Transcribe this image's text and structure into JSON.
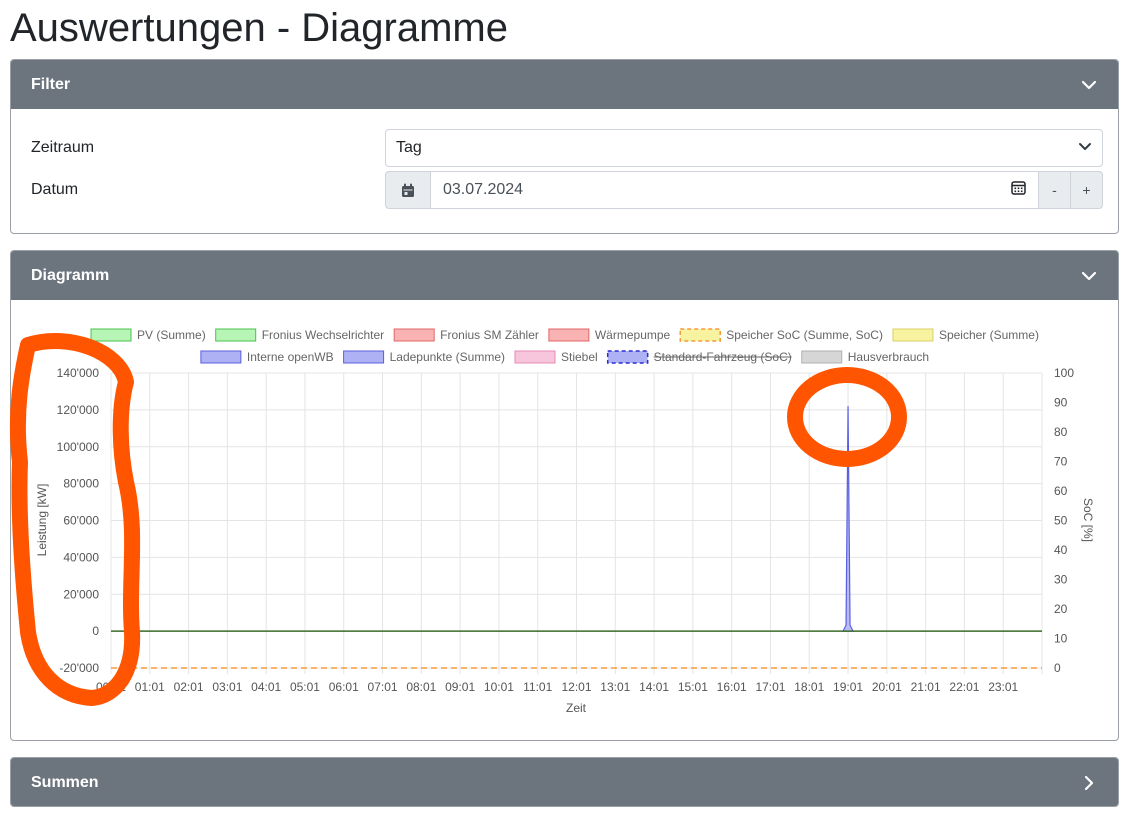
{
  "page": {
    "title": "Auswertungen - Diagramme"
  },
  "filter": {
    "header": "Filter",
    "zeitraum_label": "Zeitraum",
    "zeitraum_value": "Tag",
    "datum_label": "Datum",
    "datum_value": "03.07.2024",
    "minus_label": "-",
    "plus_label": "+"
  },
  "diagramm": {
    "header": "Diagramm"
  },
  "summen": {
    "header": "Summen"
  },
  "chart_data": {
    "type": "area",
    "title": "",
    "xlabel": "Zeit",
    "ylabel": "Leistung [kW]",
    "y2label": "SoC [%]",
    "ylim": [
      -20000,
      140000
    ],
    "y2lim": [
      0,
      100
    ],
    "yticks": [
      "-20'000",
      "0",
      "20'000",
      "40'000",
      "60'000",
      "80'000",
      "100'000",
      "120'000",
      "140'000"
    ],
    "y2ticks": [
      "0",
      "10",
      "20",
      "30",
      "40",
      "50",
      "60",
      "70",
      "80",
      "90",
      "100"
    ],
    "x": [
      "00:01",
      "01:01",
      "02:01",
      "03:01",
      "04:01",
      "05:01",
      "06:01",
      "07:01",
      "08:01",
      "09:01",
      "10:01",
      "11:01",
      "12:01",
      "13:01",
      "14:01",
      "15:01",
      "16:01",
      "17:01",
      "18:01",
      "19:01",
      "20:01",
      "21:01",
      "22:01",
      "23:01"
    ],
    "grid": true,
    "legend_position": "top",
    "legend": [
      {
        "name": "PV (Summe)",
        "fill": "#b6f5b6",
        "stroke": "#4cc24c",
        "dashed": false,
        "hidden": false
      },
      {
        "name": "Fronius Wechselrichter",
        "fill": "#b6f5b6",
        "stroke": "#4cc24c",
        "dashed": false,
        "hidden": false
      },
      {
        "name": "Fronius SM Zähler",
        "fill": "#f9b3b3",
        "stroke": "#e06666",
        "dashed": false,
        "hidden": false
      },
      {
        "name": "Wärmepumpe",
        "fill": "#f9b3b3",
        "stroke": "#e06666",
        "dashed": false,
        "hidden": false
      },
      {
        "name": "Speicher SoC (Summe, SoC)",
        "fill": "#f7f3a0",
        "stroke": "#f59b3a",
        "dashed": true,
        "hidden": false
      },
      {
        "name": "Speicher (Summe)",
        "fill": "#f7f3a0",
        "stroke": "#d8d06a",
        "dashed": false,
        "hidden": false
      },
      {
        "name": "Interne openWB",
        "fill": "#aeb2f5",
        "stroke": "#5a5ee0",
        "dashed": false,
        "hidden": false
      },
      {
        "name": "Ladepunkte (Summe)",
        "fill": "#aeb2f5",
        "stroke": "#5a5ee0",
        "dashed": false,
        "hidden": false
      },
      {
        "name": "Stiebel",
        "fill": "#f7c6dd",
        "stroke": "#e889b5",
        "dashed": false,
        "hidden": false
      },
      {
        "name": "Standard-Fahrzeug (SoC)",
        "fill": "#aeb2f5",
        "stroke": "#2a2ed0",
        "dashed": true,
        "hidden": true
      },
      {
        "name": "Hausverbrauch",
        "fill": "#d6d6d6",
        "stroke": "#b0b0b0",
        "dashed": false,
        "hidden": false
      }
    ],
    "series": [
      {
        "name": "Ladepunkte (Summe)",
        "axis": "left",
        "color": "#5a5ee0",
        "peak_time": "19:01",
        "peak_value": 122000
      },
      {
        "name": "Hausverbrauch",
        "axis": "left",
        "color": "#3a6a2a",
        "value": 0
      },
      {
        "name": "Speicher SoC (Summe, SoC)",
        "axis": "right",
        "color": "#f59b3a",
        "value": 0
      }
    ]
  },
  "colors": {
    "header_bg": "#6c757d",
    "annotation": "#ff5500"
  }
}
